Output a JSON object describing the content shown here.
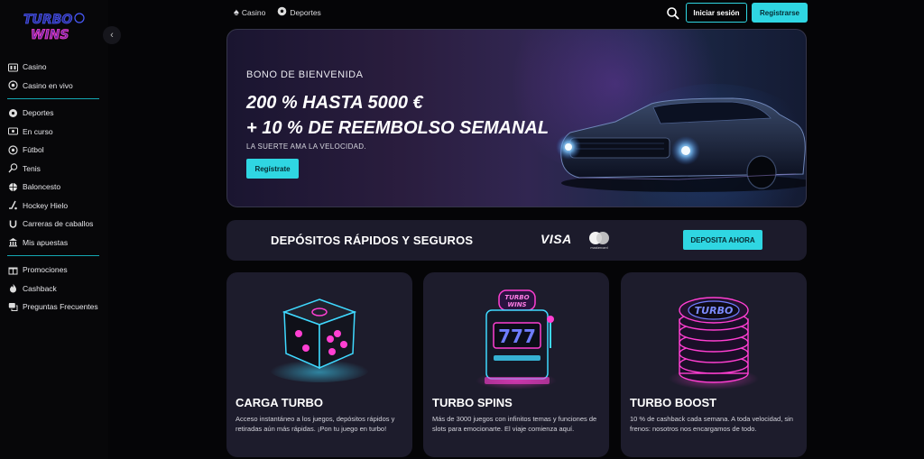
{
  "brand": {
    "logo_line1": "TURBO",
    "logo_line2": "WINS"
  },
  "sidebar": {
    "collapse_icon": "chevron-left-icon",
    "groups": [
      [
        {
          "label": "Casino",
          "icon": "casino-icon"
        },
        {
          "label": "Casino en vivo",
          "icon": "live-casino-icon"
        }
      ],
      [
        {
          "label": "Deportes",
          "icon": "sports-icon"
        },
        {
          "label": "En curso",
          "icon": "live-icon"
        },
        {
          "label": "Fútbol",
          "icon": "football-icon"
        },
        {
          "label": "Tenis",
          "icon": "tennis-icon"
        },
        {
          "label": "Baloncesto",
          "icon": "basketball-icon"
        },
        {
          "label": "Hockey Hielo",
          "icon": "hockey-icon"
        },
        {
          "label": "Carreras de caballos",
          "icon": "horseshoe-icon"
        },
        {
          "label": "Mis apuestas",
          "icon": "bets-icon"
        }
      ],
      [
        {
          "label": "Promociones",
          "icon": "gift-icon"
        },
        {
          "label": "Cashback",
          "icon": "flame-icon"
        },
        {
          "label": "Preguntas Frecuentes",
          "icon": "chat-icon"
        }
      ]
    ]
  },
  "topnav": {
    "casino_label": "Casino",
    "sports_label": "Deportes",
    "login_label": "Iniciar sesión",
    "register_label": "Registrarse"
  },
  "hero": {
    "eyebrow": "BONO DE BIENVENIDA",
    "line1": "200 % HASTA 5000 €",
    "line2": "+ 10 % DE REEMBOLSO SEMANAL",
    "tagline": "LA SUERTE AMA LA VELOCIDAD.",
    "cta": "Regístrate"
  },
  "deposit": {
    "title": "DEPÓSITOS RÁPIDOS Y SEGUROS",
    "visa": "VISA",
    "mastercard_label": "mastercard",
    "cta": "DEPOSITA AHORA"
  },
  "cards": [
    {
      "title": "CARGA TURBO",
      "desc": "Acceso instantáneo a los juegos, depósitos rápidos y retiradas aún más rápidas. ¡Pon tu juego en turbo!"
    },
    {
      "title": "TURBO SPINS",
      "desc": "Más de 3000 juegos con infinitos temas y funciones de slots para emocionarte. El viaje comienza aquí.",
      "art_text1": "TURBO",
      "art_text2": "WINS",
      "reels": "777"
    },
    {
      "title": "TURBO BOOST",
      "desc": "10 % de cashback cada semana. A toda velocidad, sin frenos: nosotros nos encargamos de todo.",
      "art_text": "TURBO"
    }
  ],
  "colors": {
    "accent": "#2fd6e2",
    "bg": "#050507",
    "card": "#1d1c2c",
    "neon_pink": "#ff3fd2"
  }
}
